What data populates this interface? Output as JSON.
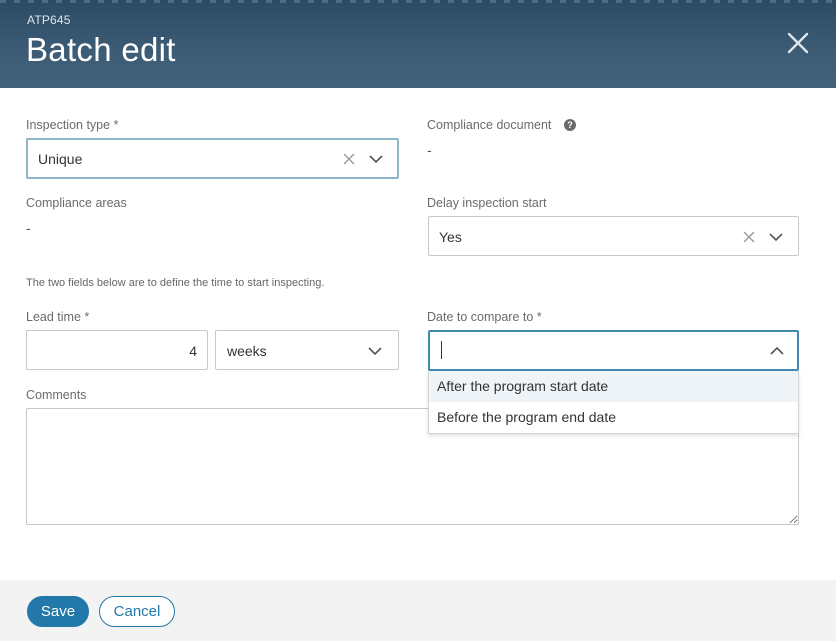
{
  "header": {
    "subtitle": "ATP645",
    "title": "Batch edit"
  },
  "form": {
    "inspection_type": {
      "label": "Inspection type *",
      "value": "Unique"
    },
    "compliance_document": {
      "label": "Compliance document",
      "value": "-"
    },
    "compliance_areas": {
      "label": "Compliance areas",
      "value": "-"
    },
    "delay_inspection_start": {
      "label": "Delay inspection start",
      "value": "Yes"
    },
    "note": "The two fields below are to define the time to start inspecting.",
    "lead_time": {
      "label": "Lead time *",
      "value": "4",
      "unit": "weeks"
    },
    "date_to_compare": {
      "label": "Date to compare to *",
      "value": "",
      "options": [
        "After the program start date",
        "Before the program end date"
      ]
    },
    "comments": {
      "label": "Comments",
      "value": ""
    }
  },
  "footer": {
    "save_label": "Save",
    "cancel_label": "Cancel"
  },
  "colors": {
    "header_bg": "#3d5c76",
    "primary": "#2278a8",
    "focus_border": "#3f8bb0"
  }
}
